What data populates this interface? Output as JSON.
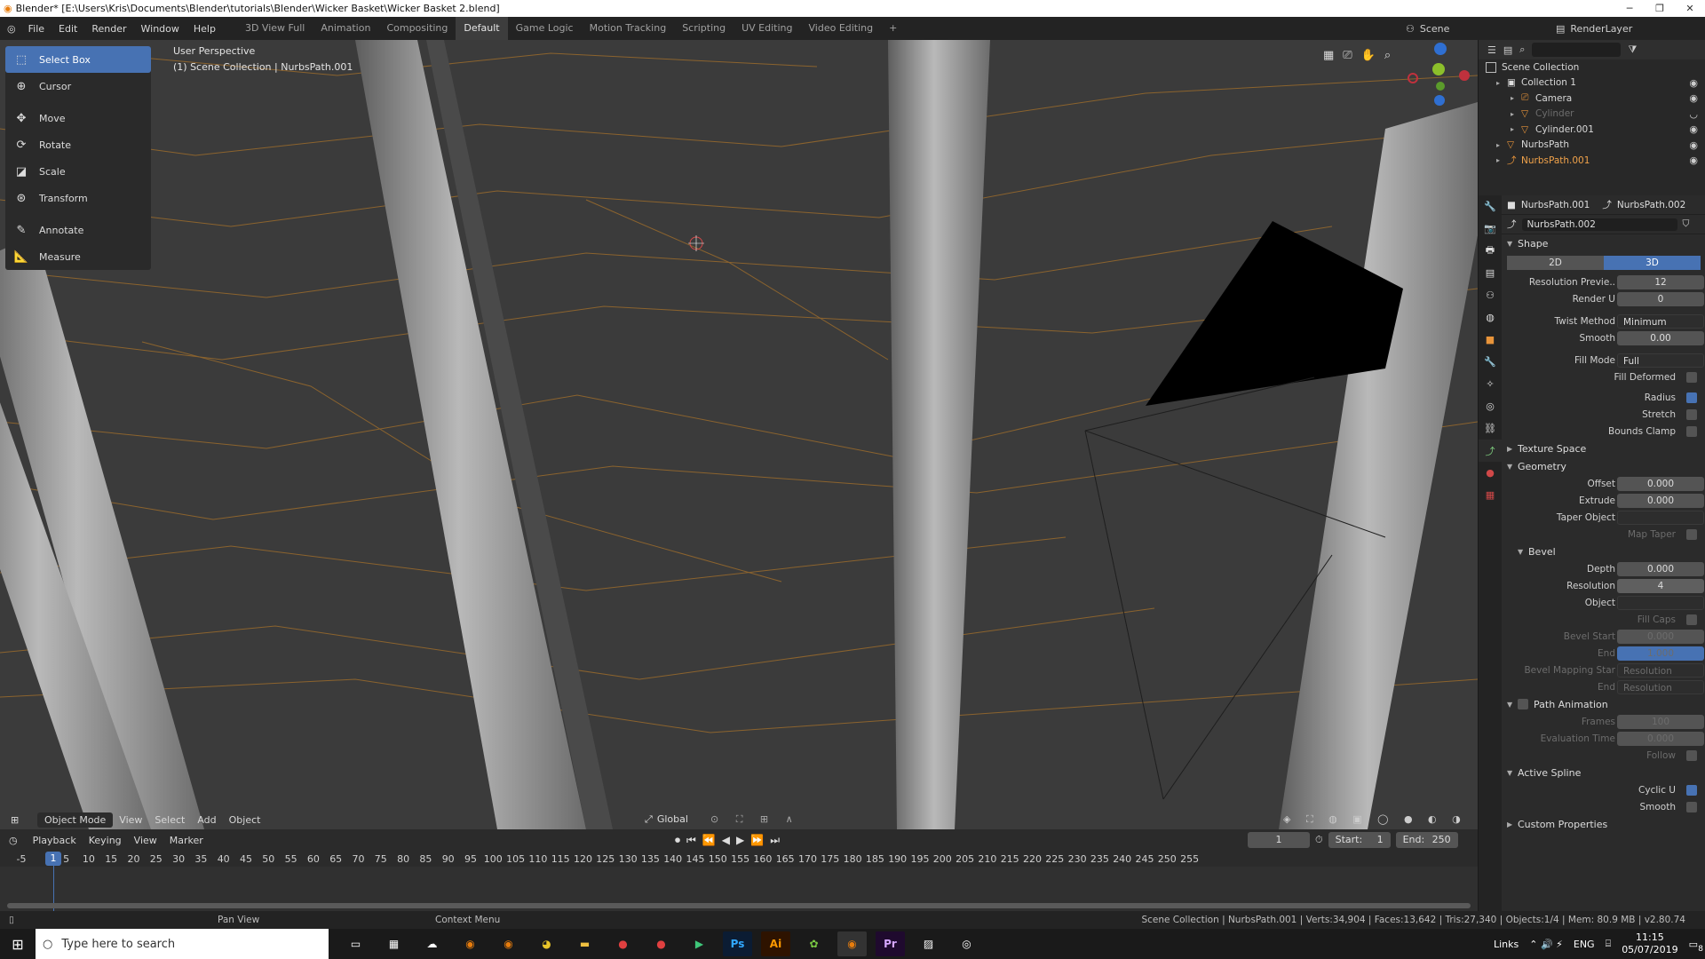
{
  "window": {
    "title": "Blender* [E:\\Users\\Kris\\Documents\\Blender\\tutorials\\Blender\\Wicker Basket\\Wicker Basket 2.blend]"
  },
  "menu": [
    "File",
    "Edit",
    "Render",
    "Window",
    "Help"
  ],
  "workspaces": [
    "3D View Full",
    "Animation",
    "Compositing",
    "Default",
    "Game Logic",
    "Motion Tracking",
    "Scripting",
    "UV Editing",
    "Video Editing",
    "+"
  ],
  "active_workspace": "Default",
  "scene": "Scene",
  "render_layer": "RenderLayer",
  "viewport": {
    "perspective": "User Perspective",
    "collection_info": "(1) Scene Collection | NurbsPath.001"
  },
  "tools": [
    "Select Box",
    "Cursor",
    "Move",
    "Rotate",
    "Scale",
    "Transform",
    "Annotate",
    "Measure"
  ],
  "viewport_header": {
    "mode": "Object Mode",
    "menus": [
      "View",
      "Select",
      "Add",
      "Object"
    ],
    "orientation": "Global"
  },
  "timeline_header": {
    "menus": [
      "Playback",
      "Keying",
      "View",
      "Marker"
    ],
    "current_frame": "1",
    "start_label": "Start:",
    "start": "1",
    "end_label": "End:",
    "end": "250"
  },
  "timeline_ticks": [
    "-5",
    "1",
    "5",
    "10",
    "15",
    "20",
    "25",
    "30",
    "35",
    "40",
    "45",
    "50",
    "55",
    "60",
    "65",
    "70",
    "75",
    "80",
    "85",
    "90",
    "95",
    "100",
    "105",
    "110",
    "115",
    "120",
    "125",
    "130",
    "135",
    "140",
    "145",
    "150",
    "155",
    "160",
    "165",
    "170",
    "175",
    "180",
    "185",
    "190",
    "195",
    "200",
    "205",
    "210",
    "215",
    "220",
    "225",
    "230",
    "235",
    "240",
    "245",
    "250",
    "255"
  ],
  "outliner": {
    "root": "Scene Collection",
    "items": [
      {
        "name": "Collection 1",
        "state": "normal"
      },
      {
        "name": "Camera",
        "state": "normal"
      },
      {
        "name": "Cylinder",
        "state": "dim"
      },
      {
        "name": "Cylinder.001",
        "state": "normal"
      },
      {
        "name": "NurbsPath",
        "state": "normal"
      },
      {
        "name": "NurbsPath.001",
        "state": "selected"
      }
    ]
  },
  "properties": {
    "breadcrumb_object": "NurbsPath.001",
    "breadcrumb_data": "NurbsPath.002",
    "datablock": "NurbsPath.002",
    "shape": {
      "title": "Shape",
      "mode_2d": "2D",
      "mode_3d": "3D",
      "rows": [
        {
          "label": "Resolution Previe..",
          "value": "12"
        },
        {
          "label": "Render U",
          "value": "0"
        },
        {
          "label": "Twist Method",
          "value": "Minimum"
        },
        {
          "label": "Smooth",
          "value": "0.00"
        },
        {
          "label": "Fill Mode",
          "value": "Full"
        }
      ],
      "checks": [
        {
          "label": "Fill Deformed",
          "on": false
        },
        {
          "label": "Radius",
          "on": true
        },
        {
          "label": "Stretch",
          "on": false
        },
        {
          "label": "Bounds Clamp",
          "on": false
        }
      ]
    },
    "texture_space": "Texture Space",
    "geometry": {
      "title": "Geometry",
      "offset_label": "Offset",
      "offset": "0.000",
      "extrude_label": "Extrude",
      "extrude": "0.000",
      "taper_label": "Taper Object",
      "map_taper": "Map Taper"
    },
    "bevel": {
      "title": "Bevel",
      "depth_label": "Depth",
      "depth": "0.000",
      "resolution_label": "Resolution",
      "resolution": "4",
      "object_label": "Object",
      "fill_caps": "Fill Caps",
      "bevel_start_label": "Bevel Start",
      "bevel_start": "0.000",
      "end_label": "End",
      "end": "1.000",
      "mapping_label": "Bevel Mapping Star",
      "mapping_start": "Resolution",
      "mapping_end_label": "End",
      "mapping_end": "Resolution"
    },
    "path_animation": {
      "title": "Path Animation",
      "frames_label": "Frames",
      "frames": "100",
      "eval_label": "Evaluation Time",
      "eval": "0.000",
      "follow": "Follow"
    },
    "active_spline": {
      "title": "Active Spline",
      "cyclic_label": "Cyclic U",
      "smooth_label": "Smooth"
    },
    "custom": "Custom Properties"
  },
  "status": {
    "left_hint": "Pan View",
    "mid_hint": "Context Menu",
    "stats": "Scene Collection | NurbsPath.001 | Verts:34,904 | Faces:13,642 | Tris:27,340 | Objects:1/4 | Mem: 80.9 MB | v2.80.74"
  },
  "taskbar": {
    "search": "Type here to search",
    "tray_links": "Links",
    "lang": "ENG",
    "time": "11:15",
    "date": "05/07/2019",
    "notifications": "8"
  },
  "colors": {
    "accent": "#4772b3",
    "selected_orange": "#f0a24a",
    "wire_orange": "#b07a2e",
    "viewport_bg": "#3b3b3b"
  }
}
